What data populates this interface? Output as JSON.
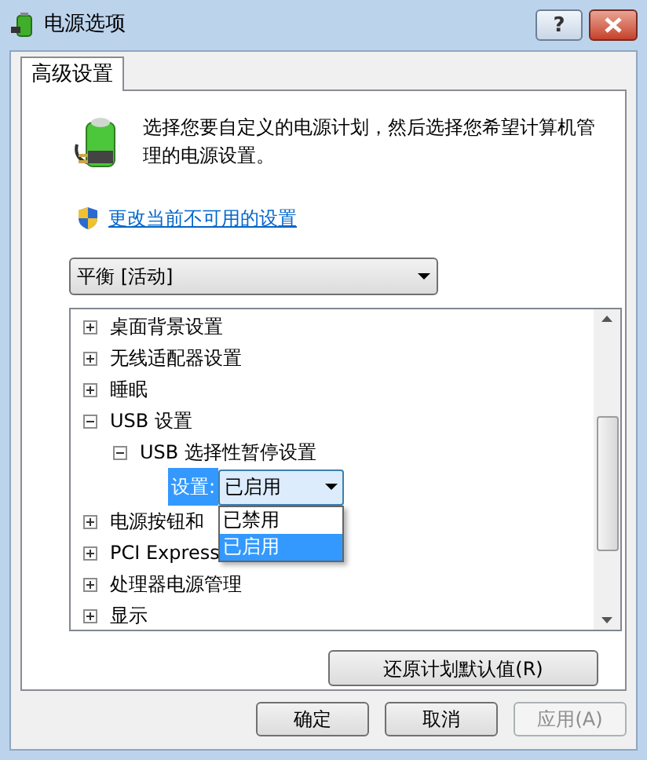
{
  "window": {
    "title": "电源选项",
    "help": "?"
  },
  "tabs": [
    {
      "label": "高级设置",
      "selected": true
    }
  ],
  "intro": "选择您要自定义的电源计划，然后选择您希望计算机管理的电源设置。",
  "link": "更改当前不可用的设置",
  "plan_select": {
    "value": "平衡 [活动]"
  },
  "tree": [
    {
      "label": "桌面背景设置",
      "expanded": false
    },
    {
      "label": "无线适配器设置",
      "expanded": false
    },
    {
      "label": "睡眠",
      "expanded": false
    },
    {
      "label": "USB 设置",
      "expanded": true,
      "children": [
        {
          "label": "USB 选择性暂停设置",
          "expanded": true,
          "setting": {
            "label": "设置:",
            "selected": true,
            "value": "已启用",
            "open": true,
            "options": [
              {
                "label": "已禁用",
                "selected": false
              },
              {
                "label": "已启用",
                "selected": true
              }
            ]
          }
        }
      ]
    },
    {
      "label": "电源按钮和",
      "expanded": false
    },
    {
      "label": "PCI Express",
      "expanded": false
    },
    {
      "label": "处理器电源管理",
      "expanded": false
    },
    {
      "label": "显示",
      "expanded": false
    }
  ],
  "restore_button": "还原计划默认值(R)",
  "buttons": [
    {
      "label": "确定",
      "disabled": false
    },
    {
      "label": "取消",
      "disabled": false
    },
    {
      "label": "应用(A)",
      "disabled": true
    }
  ]
}
